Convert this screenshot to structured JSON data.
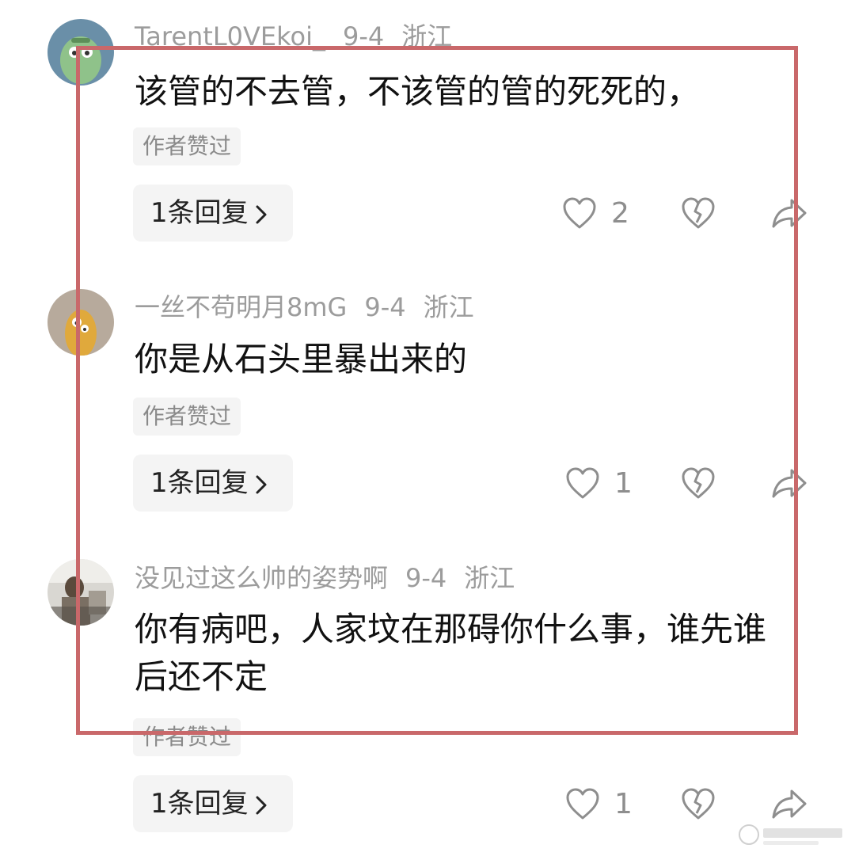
{
  "comments": [
    {
      "username": "TarentL0VEkoi_",
      "date": "9-4",
      "location": "浙江",
      "text": "该管的不去管，不该管的管的死死的，",
      "badge": "作者赞过",
      "reply_label": "1条回复",
      "likes": "2",
      "avatar_icon": "green-cartoon-avatar"
    },
    {
      "username": "一丝不苟明月8mG",
      "date": "9-4",
      "location": "浙江",
      "text": "你是从石头里暴出来的",
      "badge": "作者赞过",
      "reply_label": "1条回复",
      "likes": "1",
      "avatar_icon": "yellow-cartoon-avatar"
    },
    {
      "username": "没见过这么帅的姿势啊",
      "date": "9-4",
      "location": "浙江",
      "text": "你有病吧，人家坟在那碍你什么事，谁先谁后还不定",
      "badge": "作者赞过",
      "reply_label": "1条回复",
      "likes": "1",
      "avatar_icon": "photo-avatar"
    }
  ],
  "colors": {
    "highlight_border": "#c9686a",
    "meta_text": "#9c9c9c",
    "badge_bg": "#f4f4f4"
  }
}
